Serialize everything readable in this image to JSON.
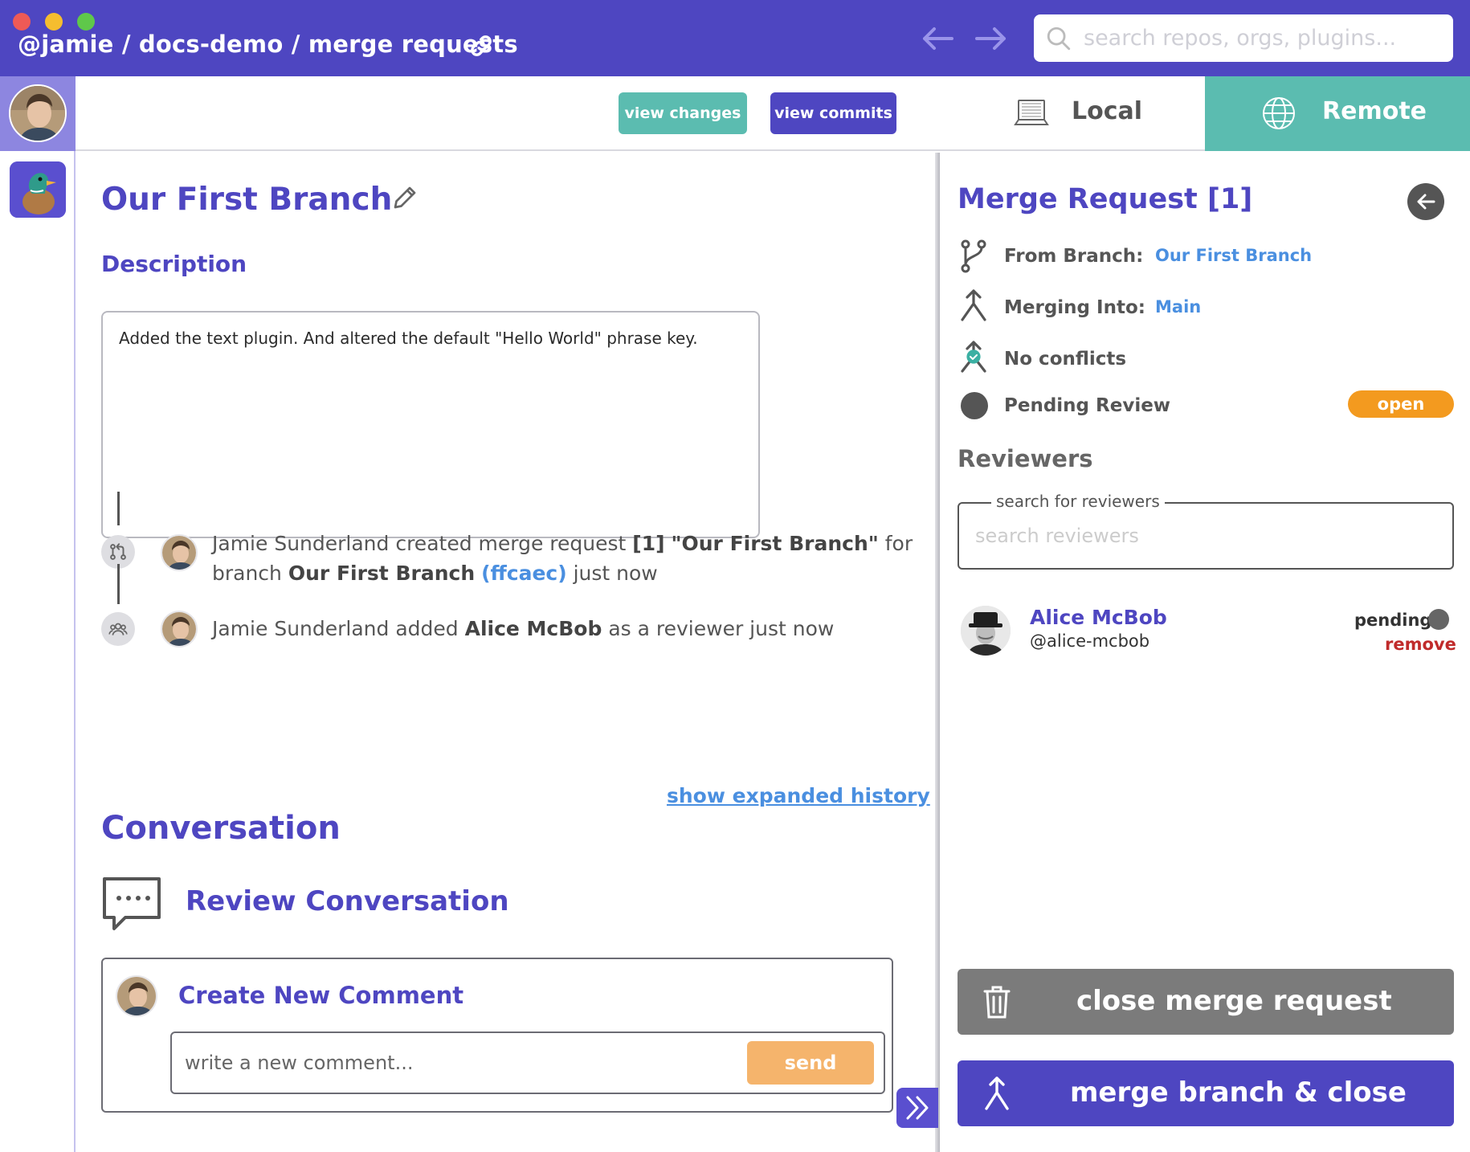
{
  "titlebar": {
    "breadcrumb": "@jamie / docs-demo / merge requests",
    "search_placeholder": "search repos, orgs, plugins..."
  },
  "toolbar": {
    "view_changes": "view changes",
    "view_commits": "view commits"
  },
  "tabs": {
    "local": "Local",
    "remote": "Remote",
    "active": "Remote"
  },
  "main": {
    "title": "Our First Branch",
    "description_label": "Description",
    "description_text": "Added the text plugin. And altered the default \"Hello World\" phrase key.",
    "timeline": [
      {
        "actor": "Jamie Sunderland",
        "t1": " created merge request ",
        "ref": "[1]",
        "t2": " ",
        "name": "\"Our First Branch\"",
        "t3": " for",
        "t4": "branch ",
        "branch": "Our First Branch",
        "hash": "(ffcaec)",
        "t5": " just now"
      },
      {
        "actor": "Jamie Sunderland",
        "t1": " added ",
        "reviewer": "Alice McBob",
        "t2": " as a reviewer just now"
      }
    ],
    "expand_history": "show expanded history",
    "conversation_title": "Conversation",
    "review_conversation": "Review Conversation",
    "create_comment": "Create New Comment",
    "comment_placeholder": "write a new comment...",
    "send": "send"
  },
  "merge_request": {
    "title": "Merge Request [1]",
    "from_label": "From Branch:",
    "from_value": "Our First Branch",
    "into_label": "Merging Into:",
    "into_value": "Main",
    "conflicts": "No conflicts",
    "review_status": "Pending Review",
    "state_badge": "open",
    "reviewers_label": "Reviewers",
    "reviewer_search_label": "search for reviewers",
    "reviewer_search_placeholder": "search reviewers",
    "reviewers": [
      {
        "name": "Alice McBob",
        "handle": "@alice-mcbob",
        "status": "pending",
        "action": "remove"
      }
    ],
    "close_button": "close merge request",
    "merge_button": "merge branch & close"
  },
  "colors": {
    "brand": "#4e46c1",
    "teal": "#5bbcb0",
    "orange": "#f39a1f",
    "link": "#4a8fe0",
    "danger": "#c02b2b"
  }
}
